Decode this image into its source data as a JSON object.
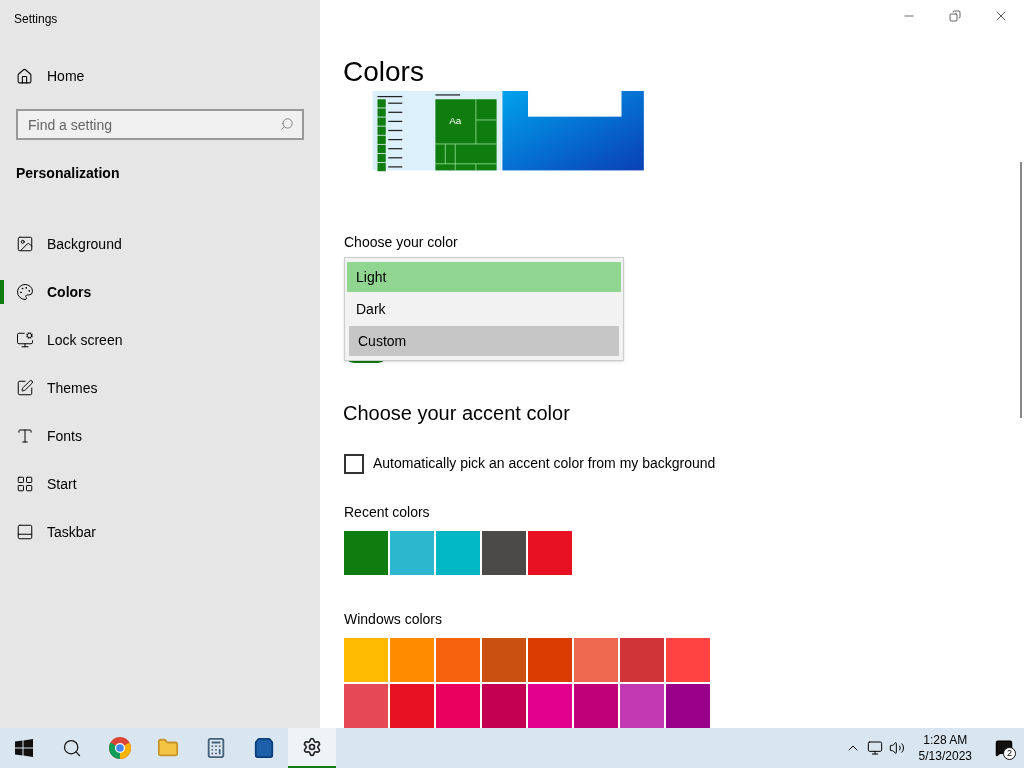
{
  "window": {
    "title": "Settings"
  },
  "sidebar": {
    "home": "Home",
    "search": {
      "placeholder": "Find a setting"
    },
    "section": "Personalization",
    "items": [
      {
        "label": "Background",
        "kind": "background",
        "selected": false
      },
      {
        "label": "Colors",
        "kind": "colors",
        "selected": true
      },
      {
        "label": "Lock screen",
        "kind": "lock",
        "selected": false
      },
      {
        "label": "Themes",
        "kind": "themes",
        "selected": false
      },
      {
        "label": "Fonts",
        "kind": "fonts",
        "selected": false
      },
      {
        "label": "Start",
        "kind": "start",
        "selected": false
      },
      {
        "label": "Taskbar",
        "kind": "taskbar",
        "selected": false
      }
    ]
  },
  "page": {
    "title": "Colors",
    "preview_label": "Aa",
    "choose_color": {
      "label": "Choose your color",
      "options": [
        {
          "label": "Light",
          "selected": true,
          "hovered": false
        },
        {
          "label": "Dark",
          "selected": false,
          "hovered": false
        },
        {
          "label": "Custom",
          "selected": false,
          "hovered": true
        }
      ]
    },
    "toggle": {
      "on": true
    },
    "accent_heading": "Choose your accent color",
    "auto_pick": {
      "label": "Automatically pick an accent color from my background",
      "checked": false
    },
    "recent_colors": {
      "label": "Recent colors",
      "swatches": [
        {
          "color": "#107c10"
        },
        {
          "color": "#2db7cf"
        },
        {
          "color": "#00b7c3"
        },
        {
          "color": "#4c4a48"
        },
        {
          "color": "#e81123"
        }
      ]
    },
    "windows_colors": {
      "label": "Windows colors",
      "swatches": [
        {
          "color": "#ffb900"
        },
        {
          "color": "#ff8c00"
        },
        {
          "color": "#f7630c"
        },
        {
          "color": "#ca5010"
        },
        {
          "color": "#da3b01"
        },
        {
          "color": "#ef6950"
        },
        {
          "color": "#d13438"
        },
        {
          "color": "#ff4343"
        },
        {
          "color": "#e74856"
        },
        {
          "color": "#e81123"
        },
        {
          "color": "#ea005e"
        },
        {
          "color": "#c30052"
        },
        {
          "color": "#e3008c"
        },
        {
          "color": "#bf0077"
        },
        {
          "color": "#c239b3"
        },
        {
          "color": "#9a0089"
        }
      ]
    }
  },
  "taskbar": {
    "apps": [
      {
        "kind": "start",
        "active": false
      },
      {
        "kind": "search",
        "active": false
      },
      {
        "kind": "chrome",
        "active": false
      },
      {
        "kind": "explorer",
        "active": false
      },
      {
        "kind": "calculator",
        "active": false
      },
      {
        "kind": "store",
        "active": false
      },
      {
        "kind": "settings",
        "active": true
      }
    ],
    "time": "1:28 AM",
    "date": "5/13/2023",
    "notifications": "2"
  }
}
